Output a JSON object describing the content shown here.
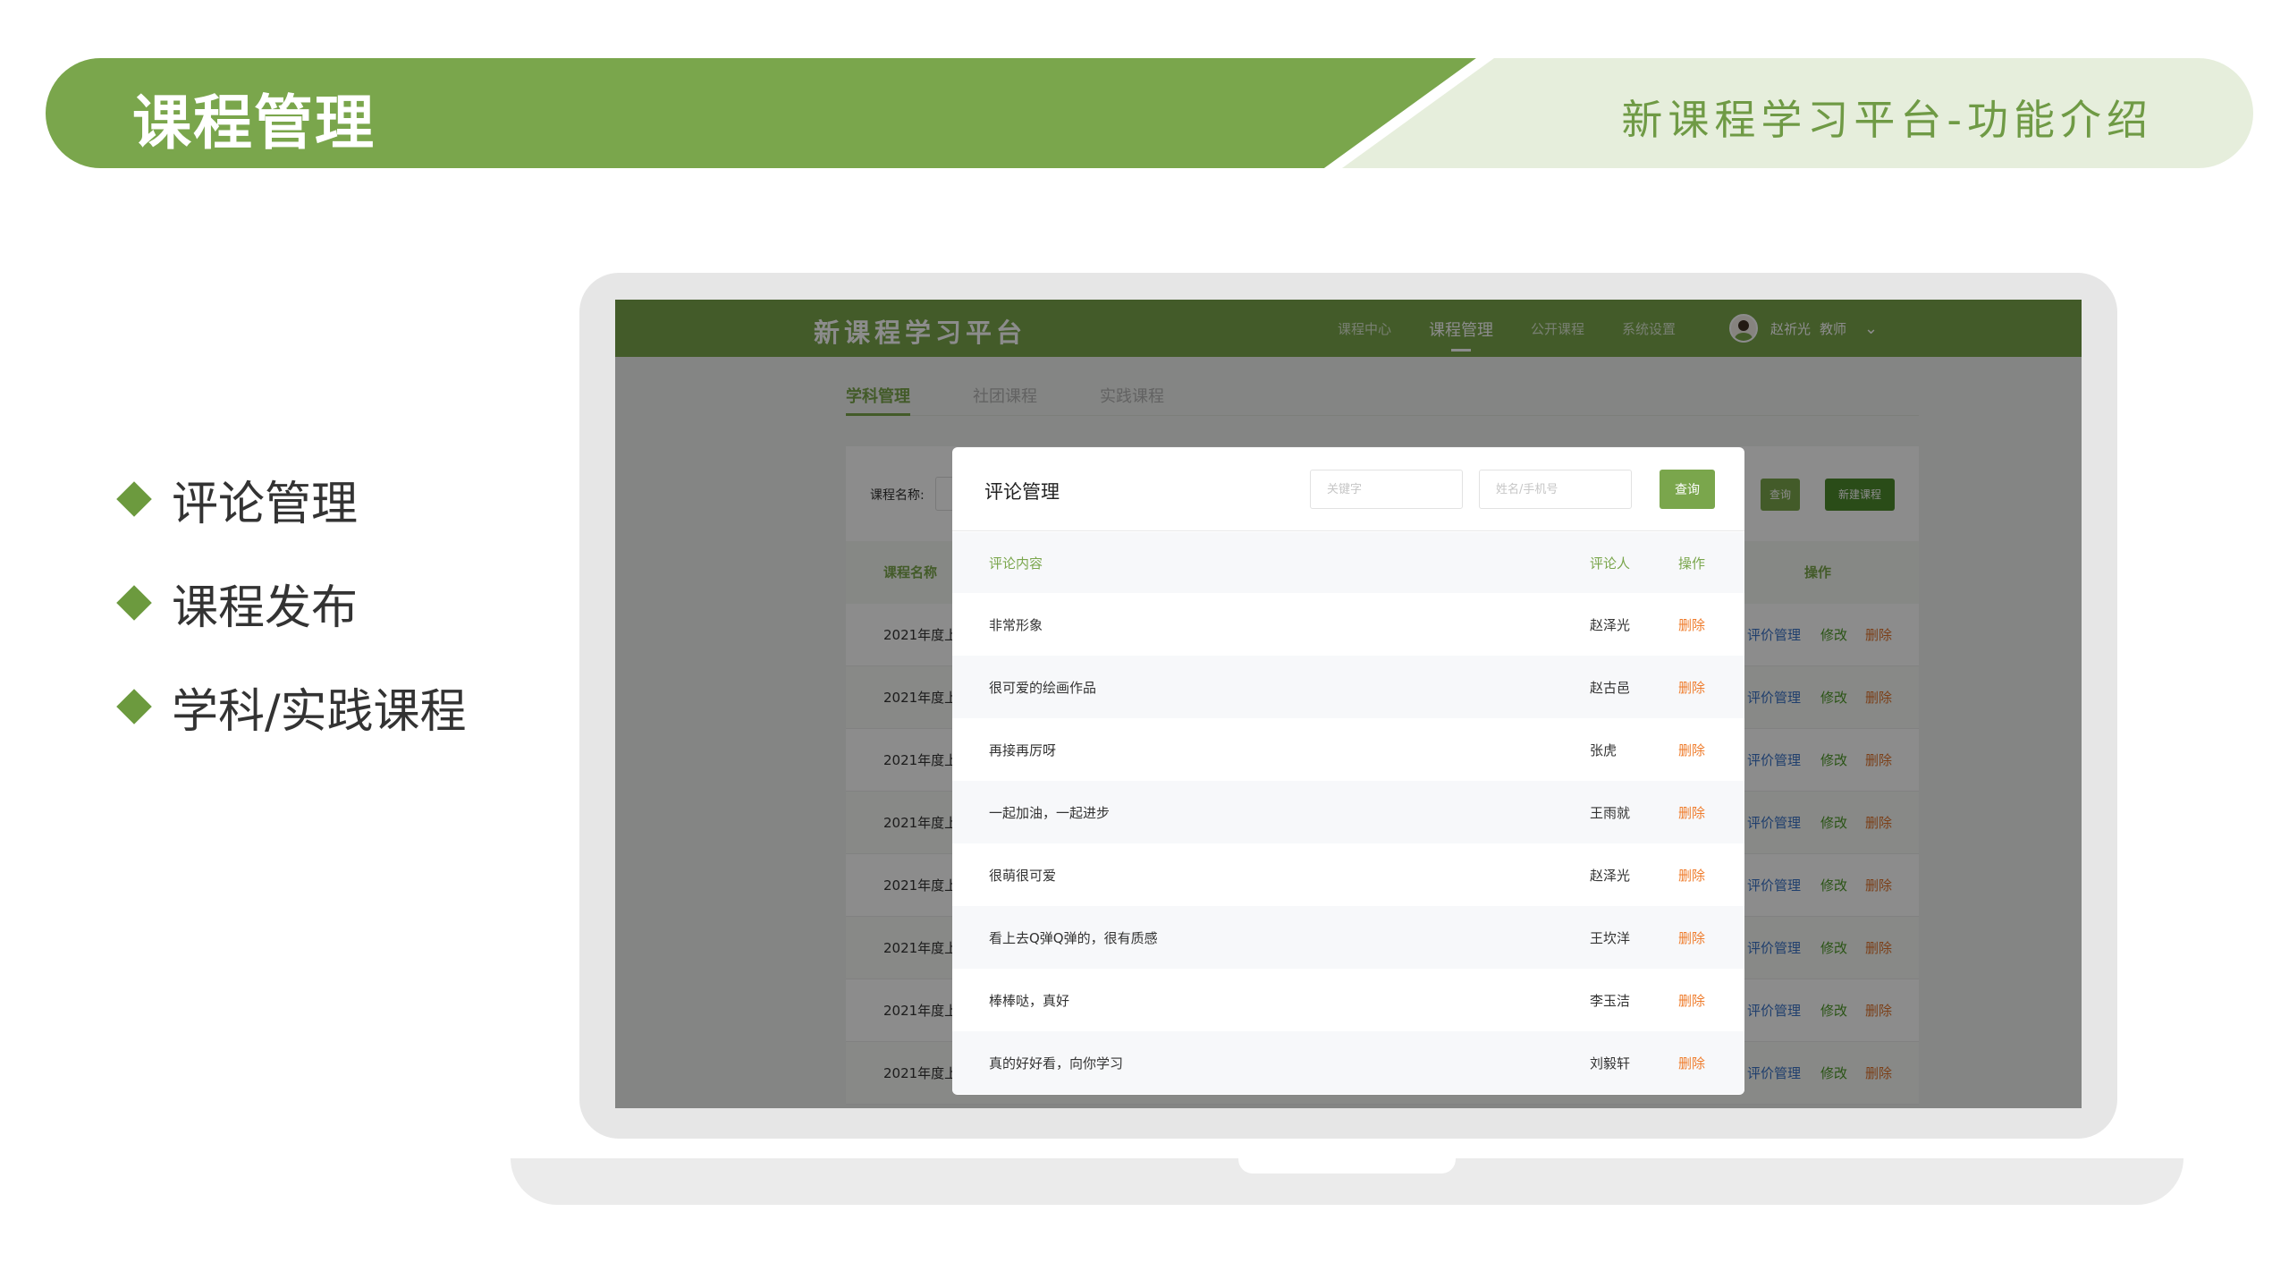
{
  "slide": {
    "title": "课程管理",
    "subtitle": "新课程学习平台-功能介绍",
    "bullets": [
      "评论管理",
      "课程发布",
      "学科/实践课程"
    ]
  },
  "app": {
    "logo": "新课程学习平台",
    "nav": [
      "课程中心",
      "课程管理",
      "公开课程",
      "系统设置"
    ],
    "active_nav": "课程管理",
    "user_name": "赵祈光",
    "user_role": "教师"
  },
  "page": {
    "tabs": [
      "学科管理",
      "社团课程",
      "实践课程"
    ],
    "filter_label": "课程名称:",
    "search_button": "查询",
    "new_button": "新建课程",
    "table": {
      "col_name": "课程名称",
      "col_op": "操作",
      "row_prefix": "2021年度上",
      "link_eval": "评价管理",
      "link_edit": "修改",
      "link_delete": "删除"
    }
  },
  "modal": {
    "title": "评论管理",
    "keyword_placeholder": "关键字",
    "name_placeholder": "姓名/手机号",
    "query_button": "查询",
    "col_content": "评论内容",
    "col_user": "评论人",
    "col_op": "操作",
    "delete_label": "删除",
    "rows": [
      {
        "content": "非常形象",
        "user": "赵泽光"
      },
      {
        "content": "很可爱的绘画作品",
        "user": "赵古邑"
      },
      {
        "content": "再接再厉呀",
        "user": "张虎"
      },
      {
        "content": "一起加油，一起进步",
        "user": "王雨就"
      },
      {
        "content": "很萌很可爱",
        "user": "赵泽光"
      },
      {
        "content": "看上去Q弹Q弹的，很有质感",
        "user": "王坎洋"
      },
      {
        "content": "棒棒哒，真好",
        "user": "李玉洁"
      },
      {
        "content": "真的好好看，向你学习",
        "user": "刘毅轩"
      }
    ]
  }
}
